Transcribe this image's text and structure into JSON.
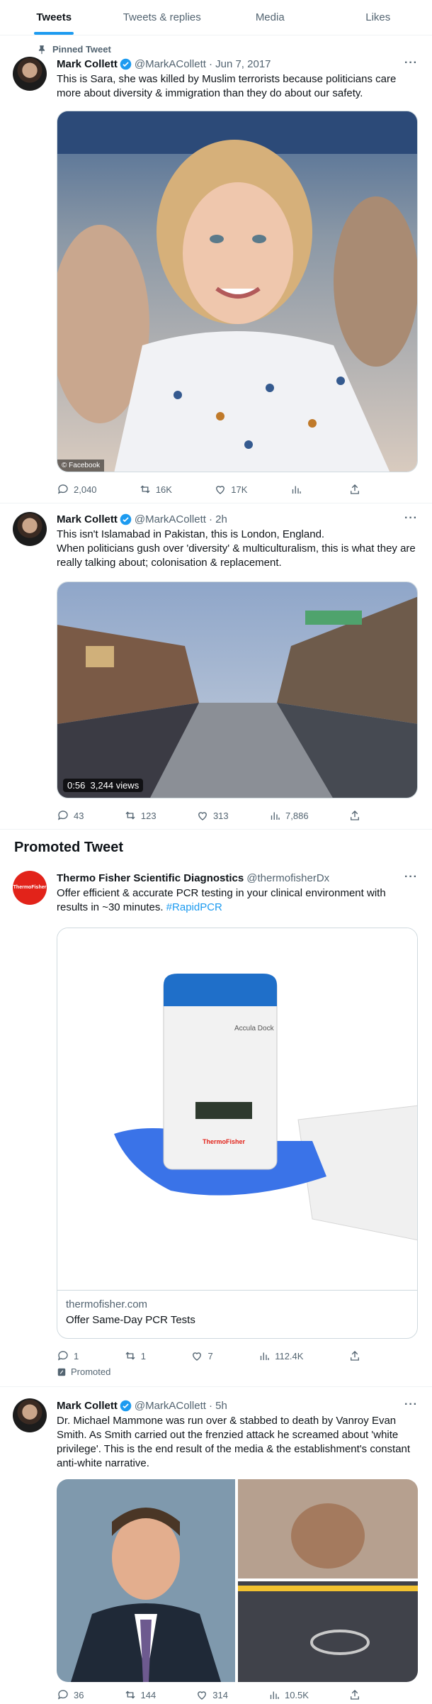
{
  "tabs": [
    {
      "label": "Tweets",
      "active": true
    },
    {
      "label": "Tweets & replies",
      "active": false
    },
    {
      "label": "Media",
      "active": false
    },
    {
      "label": "Likes",
      "active": false
    }
  ],
  "tweets": [
    {
      "pinned_label": "Pinned Tweet",
      "name": "Mark Collett",
      "handle": "@MarkACollett",
      "time": "· Jun 7, 2017",
      "text": [
        "This is Sara, she was killed by Muslim terrorists because politicians care more about diversity & immigration than they do about our safety."
      ],
      "media_tag": "© Facebook",
      "stats": {
        "replies": "2,040",
        "retweets": "16K",
        "likes": "17K",
        "views": ""
      }
    },
    {
      "name": "Mark Collett",
      "handle": "@MarkACollett",
      "time": "· 2h",
      "text": [
        "This isn't Islamabad in Pakistan, this is London, England.",
        "When politicians gush over 'diversity' & multiculturalism, this is what they are really talking about; colonisation & replacement."
      ],
      "video_duration": "0:56",
      "video_views": "3,244 views",
      "stats": {
        "replies": "43",
        "retweets": "123",
        "likes": "313",
        "views": "7,886"
      }
    },
    {
      "name": "Thermo Fisher Scientific Diagnostics",
      "handle": "@thermofisherDx",
      "avatar_text": "ThermoFisher",
      "text_before": "Offer efficient & accurate PCR testing in your clinical environment with results in ~30 minutes. ",
      "hashtag": "#RapidPCR",
      "device_label": "Accula Dock",
      "device_brand": "ThermoFisher",
      "card_domain": "thermofisher.com",
      "card_title": "Offer Same-Day PCR Tests",
      "stats": {
        "replies": "1",
        "retweets": "1",
        "likes": "7",
        "views": "112.4K"
      },
      "promoted_label": "Promoted"
    },
    {
      "name": "Mark Collett",
      "handle": "@MarkACollett",
      "time": "· 5h",
      "text": [
        "Dr. Michael Mammone was run over & stabbed to death by Vanroy Evan Smith. As Smith carried out the frenzied attack he screamed about 'white privilege'. This is the end result of the media & the establishment's constant anti-white narrative."
      ],
      "stats": {
        "replies": "36",
        "retweets": "144",
        "likes": "314",
        "views": "10.5K"
      }
    }
  ],
  "promoted_header": "Promoted Tweet",
  "colors": {
    "accent": "#1d9bf0",
    "muted": "#536471",
    "text": "#0f1419",
    "brand_red": "#e2231a"
  }
}
